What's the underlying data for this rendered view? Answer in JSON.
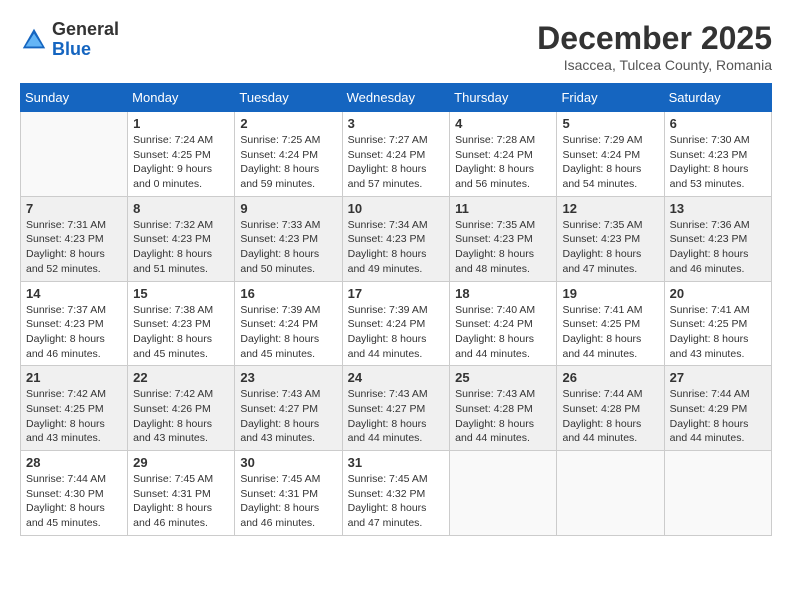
{
  "logo": {
    "general": "General",
    "blue": "Blue"
  },
  "title": "December 2025",
  "location": "Isaccea, Tulcea County, Romania",
  "weekdays": [
    "Sunday",
    "Monday",
    "Tuesday",
    "Wednesday",
    "Thursday",
    "Friday",
    "Saturday"
  ],
  "weeks": [
    [
      {
        "day": "",
        "info": ""
      },
      {
        "day": "1",
        "info": "Sunrise: 7:24 AM\nSunset: 4:25 PM\nDaylight: 9 hours\nand 0 minutes."
      },
      {
        "day": "2",
        "info": "Sunrise: 7:25 AM\nSunset: 4:24 PM\nDaylight: 8 hours\nand 59 minutes."
      },
      {
        "day": "3",
        "info": "Sunrise: 7:27 AM\nSunset: 4:24 PM\nDaylight: 8 hours\nand 57 minutes."
      },
      {
        "day": "4",
        "info": "Sunrise: 7:28 AM\nSunset: 4:24 PM\nDaylight: 8 hours\nand 56 minutes."
      },
      {
        "day": "5",
        "info": "Sunrise: 7:29 AM\nSunset: 4:24 PM\nDaylight: 8 hours\nand 54 minutes."
      },
      {
        "day": "6",
        "info": "Sunrise: 7:30 AM\nSunset: 4:23 PM\nDaylight: 8 hours\nand 53 minutes."
      }
    ],
    [
      {
        "day": "7",
        "info": "Sunrise: 7:31 AM\nSunset: 4:23 PM\nDaylight: 8 hours\nand 52 minutes."
      },
      {
        "day": "8",
        "info": "Sunrise: 7:32 AM\nSunset: 4:23 PM\nDaylight: 8 hours\nand 51 minutes."
      },
      {
        "day": "9",
        "info": "Sunrise: 7:33 AM\nSunset: 4:23 PM\nDaylight: 8 hours\nand 50 minutes."
      },
      {
        "day": "10",
        "info": "Sunrise: 7:34 AM\nSunset: 4:23 PM\nDaylight: 8 hours\nand 49 minutes."
      },
      {
        "day": "11",
        "info": "Sunrise: 7:35 AM\nSunset: 4:23 PM\nDaylight: 8 hours\nand 48 minutes."
      },
      {
        "day": "12",
        "info": "Sunrise: 7:35 AM\nSunset: 4:23 PM\nDaylight: 8 hours\nand 47 minutes."
      },
      {
        "day": "13",
        "info": "Sunrise: 7:36 AM\nSunset: 4:23 PM\nDaylight: 8 hours\nand 46 minutes."
      }
    ],
    [
      {
        "day": "14",
        "info": "Sunrise: 7:37 AM\nSunset: 4:23 PM\nDaylight: 8 hours\nand 46 minutes."
      },
      {
        "day": "15",
        "info": "Sunrise: 7:38 AM\nSunset: 4:23 PM\nDaylight: 8 hours\nand 45 minutes."
      },
      {
        "day": "16",
        "info": "Sunrise: 7:39 AM\nSunset: 4:24 PM\nDaylight: 8 hours\nand 45 minutes."
      },
      {
        "day": "17",
        "info": "Sunrise: 7:39 AM\nSunset: 4:24 PM\nDaylight: 8 hours\nand 44 minutes."
      },
      {
        "day": "18",
        "info": "Sunrise: 7:40 AM\nSunset: 4:24 PM\nDaylight: 8 hours\nand 44 minutes."
      },
      {
        "day": "19",
        "info": "Sunrise: 7:41 AM\nSunset: 4:25 PM\nDaylight: 8 hours\nand 44 minutes."
      },
      {
        "day": "20",
        "info": "Sunrise: 7:41 AM\nSunset: 4:25 PM\nDaylight: 8 hours\nand 43 minutes."
      }
    ],
    [
      {
        "day": "21",
        "info": "Sunrise: 7:42 AM\nSunset: 4:25 PM\nDaylight: 8 hours\nand 43 minutes."
      },
      {
        "day": "22",
        "info": "Sunrise: 7:42 AM\nSunset: 4:26 PM\nDaylight: 8 hours\nand 43 minutes."
      },
      {
        "day": "23",
        "info": "Sunrise: 7:43 AM\nSunset: 4:27 PM\nDaylight: 8 hours\nand 43 minutes."
      },
      {
        "day": "24",
        "info": "Sunrise: 7:43 AM\nSunset: 4:27 PM\nDaylight: 8 hours\nand 44 minutes."
      },
      {
        "day": "25",
        "info": "Sunrise: 7:43 AM\nSunset: 4:28 PM\nDaylight: 8 hours\nand 44 minutes."
      },
      {
        "day": "26",
        "info": "Sunrise: 7:44 AM\nSunset: 4:28 PM\nDaylight: 8 hours\nand 44 minutes."
      },
      {
        "day": "27",
        "info": "Sunrise: 7:44 AM\nSunset: 4:29 PM\nDaylight: 8 hours\nand 44 minutes."
      }
    ],
    [
      {
        "day": "28",
        "info": "Sunrise: 7:44 AM\nSunset: 4:30 PM\nDaylight: 8 hours\nand 45 minutes."
      },
      {
        "day": "29",
        "info": "Sunrise: 7:45 AM\nSunset: 4:31 PM\nDaylight: 8 hours\nand 46 minutes."
      },
      {
        "day": "30",
        "info": "Sunrise: 7:45 AM\nSunset: 4:31 PM\nDaylight: 8 hours\nand 46 minutes."
      },
      {
        "day": "31",
        "info": "Sunrise: 7:45 AM\nSunset: 4:32 PM\nDaylight: 8 hours\nand 47 minutes."
      },
      {
        "day": "",
        "info": ""
      },
      {
        "day": "",
        "info": ""
      },
      {
        "day": "",
        "info": ""
      }
    ]
  ]
}
